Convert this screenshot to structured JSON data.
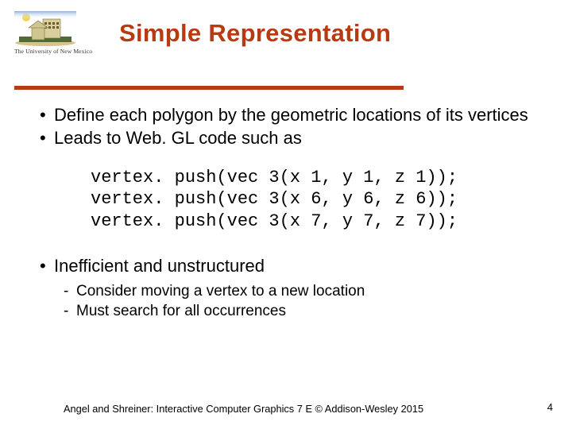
{
  "logo": {
    "caption": "The University of New Mexico"
  },
  "title": "Simple Representation",
  "bullets": {
    "b1": "Define each polygon by the geometric locations of its vertices",
    "b2": "Leads to Web. GL code such as",
    "b3": "Inefficient and unstructured"
  },
  "code": "vertex. push(vec 3(x 1, y 1, z 1));\nvertex. push(vec 3(x 6, y 6, z 6));\nvertex. push(vec 3(x 7, y 7, z 7));",
  "subs": {
    "s1": "Consider moving a vertex to a new location",
    "s2": "Must search for all occurrences"
  },
  "footer": "Angel and Shreiner: Interactive Computer Graphics 7 E © Addison-Wesley 2015",
  "page": "4"
}
